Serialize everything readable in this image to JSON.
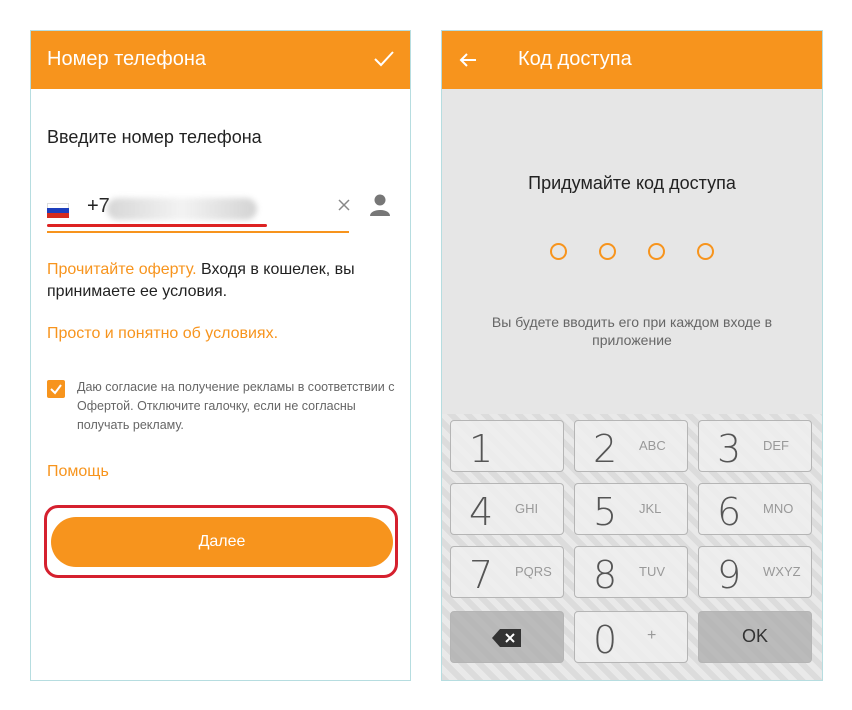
{
  "colors": {
    "accent": "#f7941d",
    "highlight": "#d5202e"
  },
  "phone_screen": {
    "title": "Номер телефона",
    "prompt": "Введите номер телефона",
    "phone_prefix": "+7",
    "offer_link": "Прочитайте оферту.",
    "offer_text": " Входя в кошелек, вы принимаете ее условия.",
    "simple_link": "Просто и понятно об условиях.",
    "consent_checked": true,
    "consent_text": "Даю согласие на получение рекламы в соответствии с Офертой. Отключите галочку, если не согласны получать рекламу.",
    "help": "Помощь",
    "next_button": "Далее",
    "icons": {
      "confirm": "check-icon",
      "clear": "close-icon",
      "contacts": "person-icon"
    }
  },
  "code_screen": {
    "title": "Код доступа",
    "prompt": "Придумайте код доступа",
    "pin_length": 4,
    "hint": "Вы будете вводить его при каждом входе в приложение",
    "keys": [
      {
        "digit": "1",
        "letters": ""
      },
      {
        "digit": "2",
        "letters": "ABC"
      },
      {
        "digit": "3",
        "letters": "DEF"
      },
      {
        "digit": "4",
        "letters": "GHI"
      },
      {
        "digit": "5",
        "letters": "JKL"
      },
      {
        "digit": "6",
        "letters": "MNO"
      },
      {
        "digit": "7",
        "letters": "PQRS"
      },
      {
        "digit": "8",
        "letters": "TUV"
      },
      {
        "digit": "9",
        "letters": "WXYZ"
      }
    ],
    "zero_key": {
      "digit": "0",
      "letters": "+"
    },
    "ok_key": "OK",
    "icons": {
      "back": "arrow-left-icon",
      "delete": "backspace-icon"
    }
  }
}
